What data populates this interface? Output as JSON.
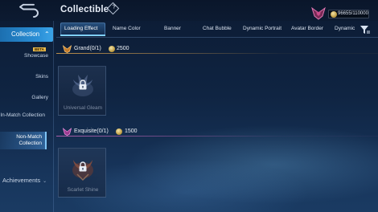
{
  "header": {
    "title": "Collectible",
    "help_label": "?",
    "currency_value": "96655/110000"
  },
  "sidebar": {
    "main_label": "Collection",
    "items": [
      {
        "label": "Showcase",
        "badge": "BETA"
      },
      {
        "label": "Skins"
      },
      {
        "label": "Gallery"
      },
      {
        "label": "In-Match Collection"
      },
      {
        "label": "Non-Match Collection",
        "active": true
      }
    ],
    "achievements_label": "Achievements"
  },
  "tabs": [
    {
      "label": "Loading Effect",
      "active": true
    },
    {
      "label": "Name Color"
    },
    {
      "label": "Banner"
    },
    {
      "label": "Chat Bubble"
    },
    {
      "label": "Dynamic Portrait"
    },
    {
      "label": "Avatar Border"
    },
    {
      "label": "Dynamic"
    }
  ],
  "sections": [
    {
      "name": "Grand(0/1)",
      "price": "2500",
      "accent": "#e6aa50",
      "items": [
        {
          "caption": "Universal Gleam",
          "locked": true
        }
      ]
    },
    {
      "name": "Exquisite(0/1)",
      "price": "1500",
      "accent": "#dc6ec8",
      "items": [
        {
          "caption": "Scarlet Shine",
          "locked": true
        }
      ]
    }
  ],
  "colors": {
    "accent_blue": "#2a8fd6",
    "gold": "#e6aa50",
    "pink": "#dc6ec8"
  },
  "icons": {
    "back": "back-arrow-icon",
    "help": "help-diamond-icon",
    "rank": "rank-crest-icon",
    "coin": "coin-icon",
    "filter": "filter-icon",
    "lock": "lock-icon",
    "grand": "grand-tier-icon",
    "exquisite": "exquisite-tier-icon"
  }
}
